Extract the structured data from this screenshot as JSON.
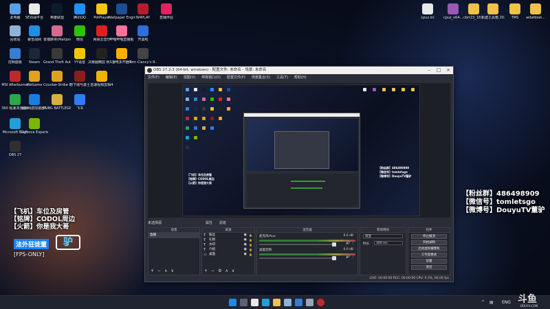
{
  "desktop": {
    "col1": [
      {
        "label": "此电脑",
        "color": "#5aa0e6"
      },
      {
        "label": "回收站",
        "color": "#8fb3d8"
      },
      {
        "label": "控制面板",
        "color": "#3a7dd0"
      },
      {
        "label": "MSI Afterburner",
        "color": "#c0292b"
      },
      {
        "label": "360 极速浏览器X",
        "color": "#2aa84a"
      },
      {
        "label": "Microsoft Edge",
        "color": "#1fa0d8"
      },
      {
        "label": "OBS 27",
        "color": "#303030"
      }
    ],
    "col2": [
      {
        "label": "5E对战平台",
        "color": "#e8e8e8"
      },
      {
        "label": "暴雪战网",
        "color": "#1e8fe0"
      },
      {
        "label": "Steam",
        "color": "#1b2838"
      },
      {
        "label": "WeGame",
        "color": "#e2a21b"
      },
      {
        "label": "海豚网游加速器5.0",
        "color": "#1a7ee0"
      },
      {
        "label": "GeForce Experience",
        "color": "#77b900"
      }
    ],
    "col3": [
      {
        "label": "英雄联盟",
        "color": "#0f1a2e"
      },
      {
        "label": "雀魂麻将(Mahjong...",
        "color": "#d66b8f"
      },
      {
        "label": "Grand Theft Auto V",
        "color": "#3a3a3a"
      },
      {
        "label": "Counter-Strike Global Off...",
        "color": "#e0a020"
      },
      {
        "label": "PUBG BATTLEGR...",
        "color": "#d8b040"
      }
    ],
    "col4": [
      {
        "label": "腾讯QQ",
        "color": "#1e90ff"
      },
      {
        "label": "微信",
        "color": "#2dc100"
      },
      {
        "label": "YY语音",
        "color": "#f2c600"
      },
      {
        "label": "地下城与勇士",
        "color": "#8b1d1d"
      },
      {
        "label": "飞书",
        "color": "#2f7df6"
      }
    ],
    "col5": [
      {
        "label": "PotPlayer",
        "color": "#f5c518"
      },
      {
        "label": "网易云音乐",
        "color": "#e02020"
      },
      {
        "label": "决赛圈精剪 帆S 代剪辑",
        "color": "#222"
      },
      {
        "label": "音速视频剪辑4",
        "color": "#f0b400"
      }
    ],
    "col6": [
      {
        "label": "Wallpaper Engine: ...",
        "color": "#1d4e8f"
      },
      {
        "label": "哔哩哔哩直播姬",
        "color": "#fb7299"
      },
      {
        "label": "雷电多开器4",
        "color": "#ffb000"
      }
    ],
    "col7": [
      {
        "label": "W4PLAY",
        "color": "#b01e2e"
      },
      {
        "label": "开黑啦",
        "color": "#2a6fdb"
      },
      {
        "label": "Tom Clancy's R...",
        "color": "#444"
      }
    ],
    "col8": [
      {
        "label": "直播伴侣",
        "color": "#e0245e"
      }
    ],
    "right_icons": [
      {
        "label": "cpuz.ini",
        "color": "#e8e8e8"
      },
      {
        "label": "cpuz_x64...",
        "color": "#9b59b6"
      },
      {
        "label": "cbrr23_18...",
        "color": "#f0c14b"
      },
      {
        "label": "新建工具箱 2022.01修...",
        "color": "#f0c14b"
      },
      {
        "label": "TMS",
        "color": "#f0c14b"
      },
      {
        "label": "aidafdest...",
        "color": "#f0c14b"
      }
    ]
  },
  "overlay_left": {
    "line1": "【飞机】车位及房管",
    "line2": "【铭牌】CODOL周边",
    "line3": "【火箭】你是我大哥",
    "badge_top": "法外狂徒董",
    "badge_logo": "驴",
    "badge_bottom": "[FPS-ONLY]"
  },
  "overlay_right": {
    "line1": "【粉丝群】486498909",
    "line2": "【微信号】tomletsgo",
    "line3": "【微博号】DouyuTV董驴"
  },
  "obs": {
    "title": "OBS 27.2.3 (64-bit, windows) - 配置文件: 未命名 - 场景: 未命名",
    "menu": [
      "文件(F)",
      "编辑(E)",
      "视图(V)",
      "停靠窗口(D)",
      "配置文件(P)",
      "场景集合(S)",
      "工具(T)",
      "帮助(H)"
    ],
    "scene_label": "未选择源",
    "tabs": [
      "属性",
      "滤镜"
    ],
    "docks": {
      "scenes": {
        "title": "场景",
        "items": [
          "直播"
        ]
      },
      "sources": {
        "title": "来源",
        "items": [
          {
            "icon": "T",
            "name": "粉丝"
          },
          {
            "icon": "T",
            "name": "礼物"
          },
          {
            "icon": "T",
            "name": "水印"
          },
          {
            "icon": "T",
            "name": "介绍"
          },
          {
            "icon": "▭",
            "name": "桌面"
          }
        ]
      },
      "mixer": {
        "title": "混音器",
        "channels": [
          {
            "name": "麦克风/Aux",
            "db": "0.0 dB"
          },
          {
            "name": "桌面音频",
            "db": "0.0 dB"
          }
        ]
      },
      "transitions": {
        "title": "转场特效",
        "type_label": "渐变",
        "duration_label": "时长",
        "duration_value": "300 ms"
      },
      "controls": {
        "title": "控件",
        "buttons": [
          "停止推流",
          "开始录制",
          "启动虚拟摄像机",
          "工作室模式",
          "设置",
          "退出"
        ]
      }
    },
    "status": "LIVE: 00:00:00   REC: 00:00:00   CPU: 0.3%, 60.00 fps"
  },
  "watermark": {
    "main": "斗鱼",
    "sub": "DOUYU.COM"
  },
  "taskbar": {
    "lang": "ENG",
    "time": "",
    "icons": [
      "windows",
      "search",
      "task-view",
      "explorer",
      "chrome",
      "edge",
      "store",
      "mail",
      "camera",
      "obs"
    ]
  }
}
